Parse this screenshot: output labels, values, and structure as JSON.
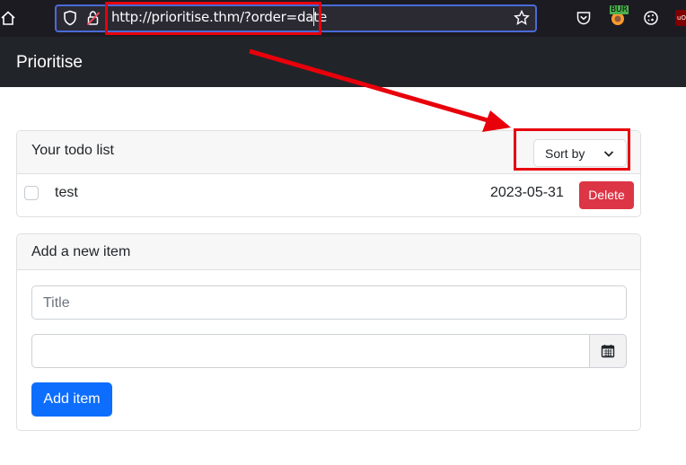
{
  "browser": {
    "url": "http://prioritise.thm/?order=date",
    "burp_badge": "BUR",
    "ublock_label": "uO"
  },
  "navbar": {
    "brand": "Prioritise"
  },
  "todo_card": {
    "header": "Your todo list",
    "sort_label": "Sort by",
    "items": [
      {
        "text": "test",
        "date": "2023-05-31",
        "delete_label": "Delete"
      }
    ]
  },
  "add_card": {
    "header": "Add a new item",
    "title_placeholder": "Title",
    "date_value": "",
    "add_label": "Add item"
  },
  "colors": {
    "annotation": "#e8000b",
    "primary": "#0d6efd",
    "danger": "#dc3545",
    "navbar": "#212529"
  }
}
